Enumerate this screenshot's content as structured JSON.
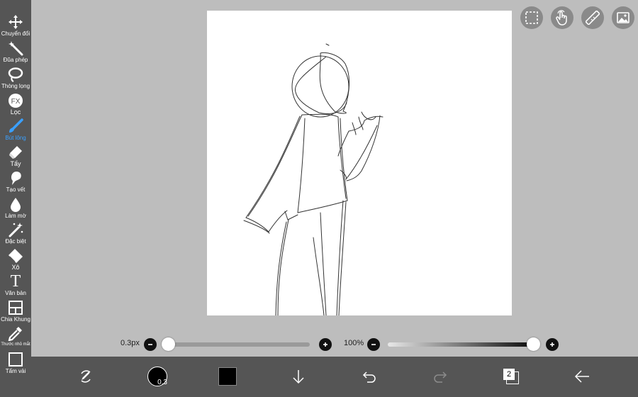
{
  "sidebar": {
    "items": [
      {
        "label": "Chuyển đổi",
        "icon": "move-icon"
      },
      {
        "label": "Đũa phép",
        "icon": "magic-wand-icon"
      },
      {
        "label": "Thòng lọng",
        "icon": "lasso-icon"
      },
      {
        "label": "Lọc",
        "icon": "fx-filter-icon",
        "badge": "FX"
      },
      {
        "label": "Bút lông",
        "icon": "brush-icon",
        "active": true
      },
      {
        "label": "Tẩy",
        "icon": "eraser-icon"
      },
      {
        "label": "Tạo vết",
        "icon": "smudge-icon"
      },
      {
        "label": "Làm mờ",
        "icon": "blur-drop-icon"
      },
      {
        "label": "Đặc biệt",
        "icon": "special-wand-icon"
      },
      {
        "label": "Xô",
        "icon": "bucket-icon"
      },
      {
        "label": "Văn bản",
        "icon": "text-icon",
        "glyph": "T"
      },
      {
        "label": "Chia Khung",
        "icon": "frame-divider-icon"
      },
      {
        "label": "Thước nhỏ mắt",
        "icon": "eyedropper-icon"
      },
      {
        "label": "Tấm vải",
        "icon": "canvas-icon"
      }
    ],
    "active_color": "#3aa0ff"
  },
  "top_buttons": [
    "selection-icon",
    "touch-icon",
    "ruler-icon",
    "image-layer-icon"
  ],
  "sliders": {
    "brush_size_label": "0.3px",
    "brush_size_value": 0.0,
    "opacity_label": "100%",
    "opacity_value": 1.0
  },
  "bottombar": {
    "brush_size_badge": "0.3",
    "current_color": "#000000",
    "layer_count": "2"
  }
}
